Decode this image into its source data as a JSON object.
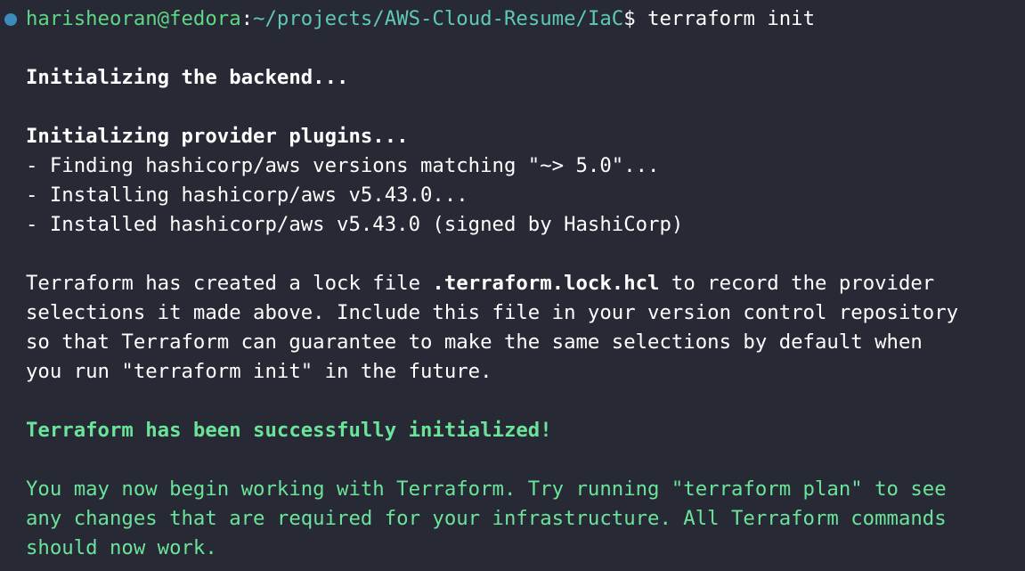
{
  "prompt": {
    "user_host": "harisheoran@fedora",
    "colon": ":",
    "path": "~/projects/AWS-Cloud-Resume/IaC",
    "dollar": "$",
    "command": " terraform init"
  },
  "output": {
    "init_backend": "Initializing the backend...",
    "init_plugins": "Initializing provider plugins...",
    "finding": "- Finding hashicorp/aws versions matching \"~> 5.0\"...",
    "installing": "- Installing hashicorp/aws v5.43.0...",
    "installed": "- Installed hashicorp/aws v5.43.0 (signed by HashiCorp)",
    "lock_pre": "Terraform has created a lock file ",
    "lock_file": ".terraform.lock.hcl",
    "lock_post": " to record the provider",
    "lock_line2": "selections it made above. Include this file in your version control repository",
    "lock_line3": "so that Terraform can guarantee to make the same selections by default when",
    "lock_line4": "you run \"terraform init\" in the future.",
    "success": "Terraform has been successfully initialized!",
    "next_line1": "You may now begin working with Terraform. Try running \"terraform plan\" to see",
    "next_line2": "any changes that are required for your infrastructure. All Terraform commands",
    "next_line3": "should now work."
  },
  "colors": {
    "background": "#272a35",
    "success_green": "#6be39a",
    "prompt_user": "#5fd787",
    "prompt_path": "#5fc9b5",
    "status_dot": "#3d8bbd"
  }
}
